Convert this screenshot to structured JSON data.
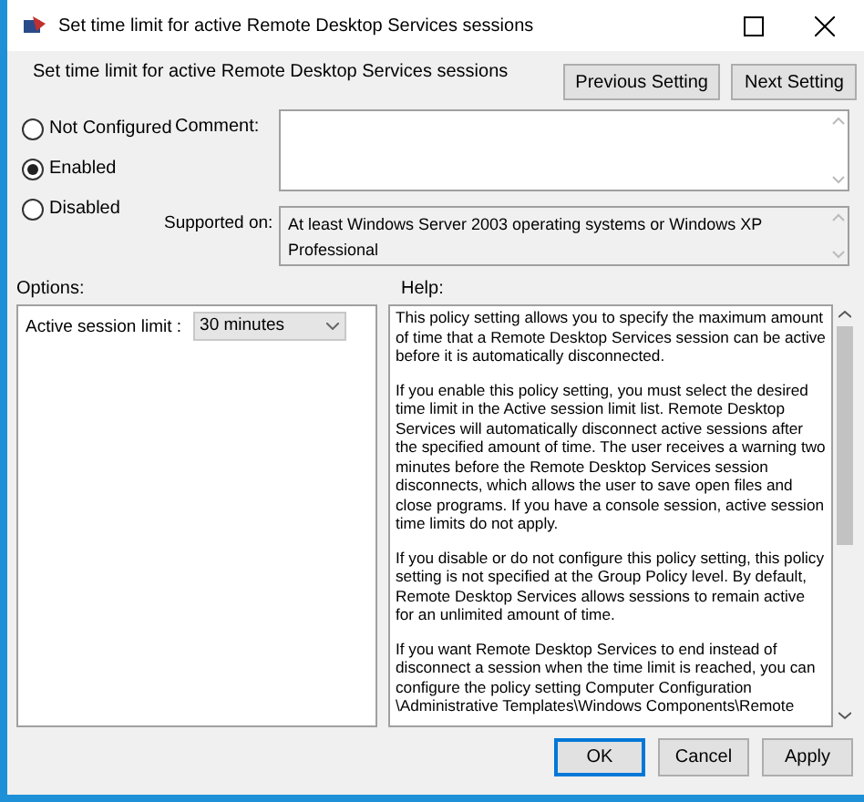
{
  "window": {
    "title": "Set time limit for active Remote Desktop Services sessions"
  },
  "header": {
    "policy_title": "Set time limit for active Remote Desktop Services sessions",
    "buttons": [
      "Previous Setting",
      "Next Setting"
    ]
  },
  "state_options": [
    {
      "label": "Not Configured",
      "selected": false
    },
    {
      "label": "Enabled",
      "selected": true
    },
    {
      "label": "Disabled",
      "selected": false
    }
  ],
  "comment": {
    "label": "Comment:"
  },
  "supported_on": {
    "label": "Supported on:",
    "value": "At least Windows Server 2003 operating systems or Windows XP Professional"
  },
  "options": {
    "label": "Options:",
    "field_label": "Active session limit :",
    "value": "30 minutes"
  },
  "help": {
    "label": "Help:",
    "paragraphs": [
      "This policy setting allows you to specify the maximum amount of time that a Remote Desktop Services session can be active before it is automatically disconnected.",
      "If you enable this policy setting, you must select the desired time limit in the Active session limit list. Remote Desktop Services will automatically disconnect active sessions after the specified amount of time. The user receives a warning two minutes before the Remote Desktop Services session disconnects, which allows the user to save open files and close programs. If you have a console session, active session time limits do not apply.",
      "If you disable or do not configure this policy setting, this policy setting is not specified at the Group Policy level. By default, Remote Desktop Services allows sessions to remain active for an unlimited amount of time.",
      "If you want Remote Desktop Services to end instead of disconnect a session when the time limit is reached, you can configure the policy setting Computer Configuration \\Administrative Templates\\Windows Components\\Remote"
    ]
  },
  "footer_buttons": [
    {
      "label": "OK",
      "selected": true
    },
    {
      "label": "Cancel",
      "selected": false
    },
    {
      "label": "Apply",
      "selected": false
    }
  ]
}
